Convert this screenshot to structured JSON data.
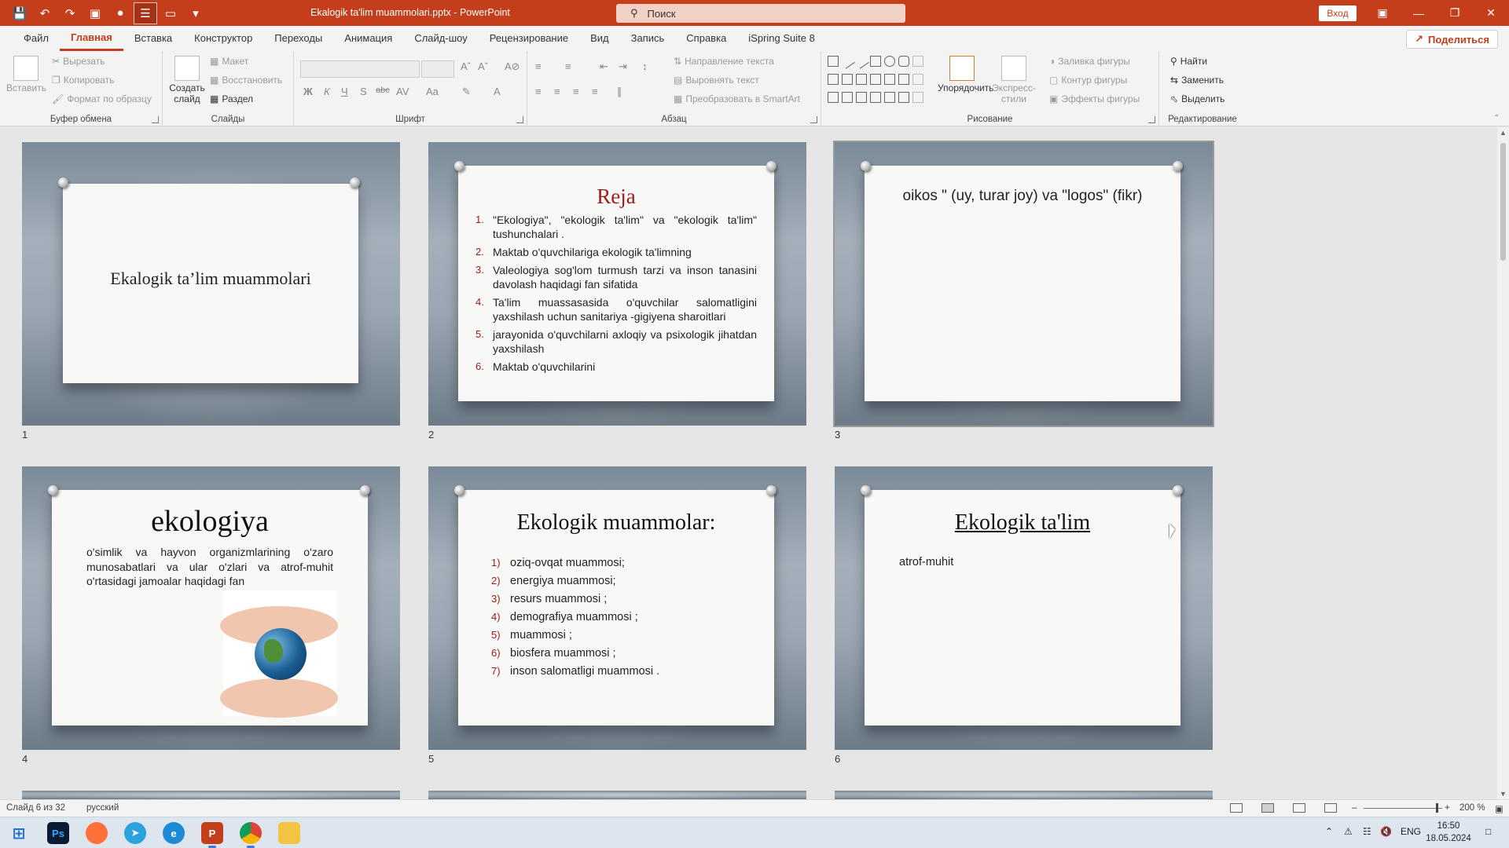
{
  "window": {
    "title": "Ekalogik ta'lim muammolari.pptx  -  PowerPoint",
    "search_placeholder": "Поиск",
    "login_label": "Вход",
    "share_label": "Поделиться",
    "accent_color": "#c43e1c"
  },
  "menu": {
    "tabs": [
      "Файл",
      "Главная",
      "Вставка",
      "Конструктор",
      "Переходы",
      "Анимация",
      "Слайд-шоу",
      "Рецензирование",
      "Вид",
      "Запись",
      "Справка",
      "iSpring Suite 8"
    ],
    "active": "Главная"
  },
  "ribbon": {
    "clipboard": {
      "label": "Буфер обмена",
      "paste": "Вставить",
      "cut": "Вырезать",
      "copy": "Копировать",
      "format_painter": "Формат по образцу"
    },
    "slides": {
      "label": "Слайды",
      "new_slide": "Создать слайд",
      "layout": "Макет",
      "reset": "Восстановить",
      "section": "Раздел"
    },
    "font": {
      "label": "Шрифт",
      "bold": "Ж",
      "italic": "К",
      "underline": "Ч",
      "shadow": "S",
      "strike": "abc",
      "spacing": "AV",
      "case": "Aa"
    },
    "paragraph": {
      "label": "Абзац",
      "text_direction": "Направление текста",
      "align_text": "Выровнять текст",
      "smartart": "Преобразовать в SmartArt"
    },
    "drawing": {
      "label": "Рисование",
      "arrange": "Упорядочить",
      "quick_styles": "Экспресс-стили",
      "shape_fill": "Заливка фигуры",
      "shape_outline": "Контур фигуры",
      "shape_effects": "Эффекты фигуры"
    },
    "editing": {
      "label": "Редактирование",
      "find": "Найти",
      "replace": "Заменить",
      "select": "Выделить"
    }
  },
  "slides": [
    {
      "num": "1",
      "title": "Ekalogik ta’lim muammolari"
    },
    {
      "num": "2",
      "title": "Reja",
      "items": [
        {
          "n": "1.",
          "text": "\"Ekologiya\", \"ekologik ta'lim\" va \"ekologik ta'lim\" tushunchalari ."
        },
        {
          "n": "2.",
          "text": "Maktab o'quvchilariga ekologik ta'limning"
        },
        {
          "n": "3.",
          "text": "Valeologiya sog'lom turmush tarzi va inson tanasini davolash haqidagi fan sifatida"
        },
        {
          "n": "4.",
          "text": "Ta'lim muassasasida o'quvchilar salomatligini yaxshilash uchun sanitariya -gigiyena sharoitlari"
        },
        {
          "n": "5.",
          "text": "jarayonida o'quvchilarni axloqiy va psixologik jihatdan yaxshilash"
        },
        {
          "n": "6.",
          "text": "Maktab o'quvchilarini"
        }
      ]
    },
    {
      "num": "3",
      "text": "oikos \" (uy, turar joy) va \"logos\" (fikr)"
    },
    {
      "num": "4",
      "title": "ekologiya",
      "text": "o'simlik va hayvon organizmlarining o'zaro munosabatlari va ular o'zlari va atrof-muhit o'rtasidagi jamoalar haqidagi fan"
    },
    {
      "num": "5",
      "title": "Ekologik muammolar:",
      "items": [
        {
          "n": "1)",
          "text": "oziq-ovqat muammosi;"
        },
        {
          "n": "2)",
          "text": "energiya muammosi;"
        },
        {
          "n": "3)",
          "text": "resurs muammosi ;"
        },
        {
          "n": "4)",
          "text": "demografiya muammosi ;"
        },
        {
          "n": "5)",
          "text": "muammosi ;"
        },
        {
          "n": "6)",
          "text": "biosfera muammosi ;"
        },
        {
          "n": "7)",
          "text": "inson salomatligi muammosi ."
        }
      ]
    },
    {
      "num": "6",
      "title": "Ekologik ta'lim",
      "text": "atrof-muhit"
    }
  ],
  "status": {
    "slide_info": "Слайд 6 из 32",
    "language": "русский",
    "zoom": "200 %"
  },
  "taskbar": {
    "apps": [
      "start-icon",
      "photoshop-icon",
      "firefox-icon",
      "telegram-icon",
      "edge-icon",
      "powerpoint-icon",
      "chrome-icon",
      "explorer-icon"
    ],
    "lang": "ENG",
    "time": "16:50",
    "date": "18.05.2024"
  }
}
